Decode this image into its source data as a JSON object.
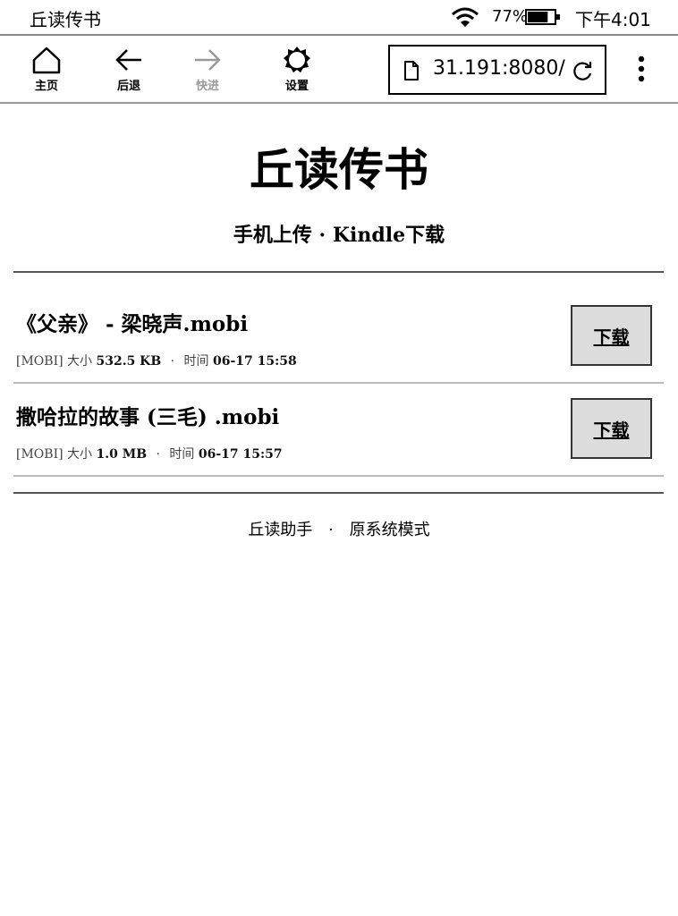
{
  "status_bar": {
    "app_title": "丘读传书",
    "battery_percent": "77%",
    "battery_level": 0.77,
    "time": "下午4:01"
  },
  "toolbar": {
    "home_label": "主页",
    "back_label": "后退",
    "forward_label": "快进",
    "settings_label": "设置",
    "url": "31.191:8080/"
  },
  "page": {
    "title": "丘读传书",
    "subtitle": "手机上传 · Kindle下载",
    "meta_size_label": "大小",
    "meta_time_label": "时间",
    "download_label": "下载",
    "files": [
      {
        "name": "《父亲》 - 梁晓声.mobi",
        "format": "[MOBI]",
        "size": "532.5 KB",
        "time": "06-17 15:58"
      },
      {
        "name": "撒哈拉的故事 (三毛) .mobi",
        "format": "[MOBI]",
        "size": "1.0 MB",
        "time": "06-17 15:57"
      }
    ],
    "footer_left": "丘读助手",
    "footer_sep": "·",
    "footer_right": "原系统模式"
  }
}
